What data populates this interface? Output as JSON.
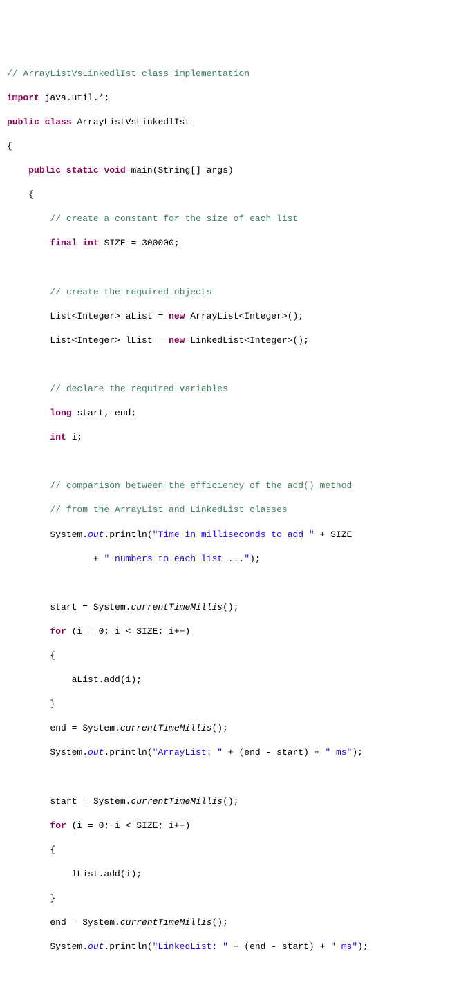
{
  "lines": {
    "c1": "// ArrayListVsLinkedlIst class implementation",
    "kw_import": "import",
    "imp_pkg": " java.util.*;",
    "kw_public": "public",
    "kw_class": "class",
    "classname": " ArrayListVsLinkedlIst",
    "brace_open": "{",
    "kw_static": "static",
    "kw_void": "void",
    "main_sig": " main(String[] args)",
    "c2": "// create a constant for the size of each list",
    "kw_final": "final",
    "kw_int": "int",
    "size_decl": " SIZE = 300000;",
    "c3": "// create the required objects",
    "list_a_lhs": "List<Integer> aList = ",
    "kw_new": "new",
    "arraylist_ctor": " ArrayList<Integer>();",
    "list_l_lhs": "List<Integer> lList = ",
    "linkedlist_ctor": " LinkedList<Integer>();",
    "c4": "// declare the required variables",
    "kw_long": "long",
    "startend": " start, end;",
    "int_i": " i;",
    "c5": "// comparison between the efficiency of the add() method",
    "c6": "// from the ArrayList and LinkedList classes",
    "sys": "System.",
    "out": "out",
    "println": ".println(",
    "s_time": "\"Time in milliseconds to add \"",
    "plus_size": " + SIZE",
    "s_numbers": "\" numbers to each list ...\"",
    "close_paren": ");",
    "start_eq": "start = System.",
    "ctm": "currentTimeMillis",
    "paren_semi": "();",
    "kw_for": "for",
    "for_hdr": " (i = 0; i < SIZE; i++)",
    "alist_add": "aList.add(i);",
    "brace_close": "}",
    "end_eq": "end = System.",
    "s_arraylist": "\"ArrayList: \"",
    "plus_endstart": " + (end - start) + ",
    "s_ms": "\" ms\"",
    "llist_add": "lList.add(i);",
    "s_linkedlist": "\"LinkedList: \"",
    "plus": " + "
  }
}
